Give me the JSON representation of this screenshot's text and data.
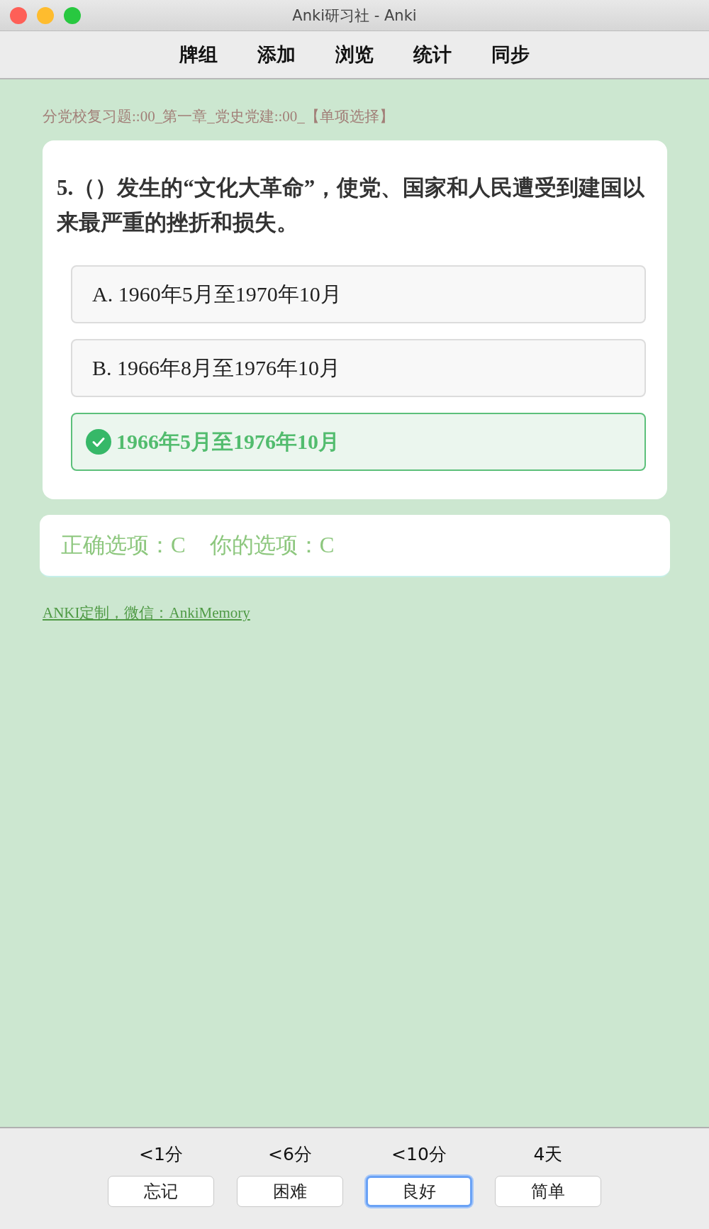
{
  "window": {
    "title": "Anki研习社 - Anki"
  },
  "toolbar": [
    "牌组",
    "添加",
    "浏览",
    "统计",
    "同步"
  ],
  "deck_path": "分党校复习题::00_第一章_党史党建::00_【单项选择】",
  "question": "5.（）发生的“文化大革命”，使党、国家和人民遭受到建国以来最严重的挫折和损失。",
  "options": [
    {
      "text": "A. 1960年5月至1970年10月",
      "correct": false
    },
    {
      "text": "B. 1966年8月至1976年10月",
      "correct": false
    },
    {
      "text": "1966年5月至1976年10月",
      "correct": true
    }
  ],
  "result": {
    "correct_label": "正确选项：C",
    "your_label": "你的选项：C"
  },
  "footer_link": "ANKI定制，微信：AnkiMemory",
  "answer_buttons": [
    {
      "interval": "<1分",
      "label": "忘记",
      "focused": false
    },
    {
      "interval": "<6分",
      "label": "困难",
      "focused": false
    },
    {
      "interval": "<10分",
      "label": "良好",
      "focused": true
    },
    {
      "interval": "4天",
      "label": "简单",
      "focused": false
    }
  ]
}
